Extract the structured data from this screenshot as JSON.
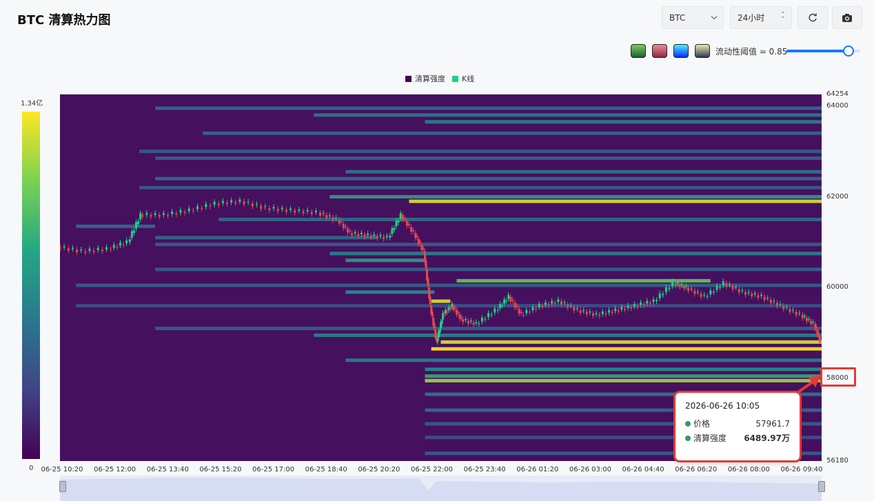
{
  "header": {
    "title": "BTC 清算热力图",
    "symbol": "BTC",
    "range": "24小时",
    "threshold_label": "流动性阈值 = 0.85"
  },
  "controls": {
    "threshold_value": 0.85,
    "swatches": [
      {
        "name": "viridis",
        "from": "#1c5c3f",
        "to": "#7ad151"
      },
      {
        "name": "reds",
        "from": "#8e2a3e",
        "to": "#f08a9a"
      },
      {
        "name": "blues",
        "from": "#0a2bff",
        "to": "#4ff0ff"
      },
      {
        "name": "sand",
        "from": "#2a3a55",
        "to": "#f4e6b0"
      }
    ]
  },
  "legend": {
    "liquidation": "清算强度",
    "kline": "K线",
    "liquidation_color": "#440154",
    "kline_color": "#1fd18a"
  },
  "colorbar": {
    "max_label": "1.34亿",
    "min_label": "0"
  },
  "tooltip": {
    "time": "2026-06-26 10:05",
    "price_label": "价格",
    "price_value": "57961.7",
    "intensity_label": "清算强度",
    "intensity_value": "6489.97万"
  },
  "highlight_price": "58000",
  "chart_data": {
    "type": "heatmap",
    "title": "BTC 清算热力图",
    "y_range": [
      56180,
      64254
    ],
    "y_ticks": [
      "64254",
      "64000",
      "62000",
      "60000",
      "58000",
      "56180"
    ],
    "x_ticks": [
      "06-25 10:20",
      "06-25 12:00",
      "06-25 13:40",
      "06-25 15:20",
      "06-25 17:00",
      "06-25 18:40",
      "06-25 20:20",
      "06-25 22:00",
      "06-25 23:40",
      "06-26 01:20",
      "06-26 03:00",
      "06-26 04:40",
      "06-26 06:20",
      "06-26 08:00",
      "06-26 09:40"
    ],
    "x_range_hours": [
      0,
      24
    ],
    "price_path": [
      [
        0.0,
        60900
      ],
      [
        0.8,
        60800
      ],
      [
        1.6,
        60850
      ],
      [
        2.2,
        61000
      ],
      [
        2.6,
        61600
      ],
      [
        3.4,
        61600
      ],
      [
        4.2,
        61700
      ],
      [
        5.0,
        61850
      ],
      [
        5.8,
        61900
      ],
      [
        6.6,
        61750
      ],
      [
        7.4,
        61700
      ],
      [
        8.2,
        61650
      ],
      [
        8.8,
        61500
      ],
      [
        9.2,
        61200
      ],
      [
        9.8,
        61150
      ],
      [
        10.4,
        61100
      ],
      [
        10.8,
        61600
      ],
      [
        11.2,
        61200
      ],
      [
        11.5,
        60800
      ],
      [
        11.7,
        59600
      ],
      [
        11.9,
        58800
      ],
      [
        12.1,
        59400
      ],
      [
        12.4,
        59600
      ],
      [
        12.7,
        59300
      ],
      [
        13.2,
        59200
      ],
      [
        13.8,
        59500
      ],
      [
        14.2,
        59800
      ],
      [
        14.6,
        59400
      ],
      [
        15.2,
        59600
      ],
      [
        15.8,
        59700
      ],
      [
        16.4,
        59500
      ],
      [
        17.0,
        59400
      ],
      [
        17.6,
        59500
      ],
      [
        18.2,
        59600
      ],
      [
        18.8,
        59700
      ],
      [
        19.4,
        60100
      ],
      [
        19.8,
        60000
      ],
      [
        20.4,
        59800
      ],
      [
        21.0,
        60100
      ],
      [
        21.6,
        59900
      ],
      [
        22.2,
        59800
      ],
      [
        22.8,
        59600
      ],
      [
        23.4,
        59400
      ],
      [
        23.8,
        59200
      ],
      [
        24.0,
        58800
      ]
    ],
    "liquidation_levels": [
      {
        "price": 63950,
        "start": 3.0,
        "end": 24.0,
        "intensity": 0.35
      },
      {
        "price": 63800,
        "start": 8.0,
        "end": 24.0,
        "intensity": 0.4
      },
      {
        "price": 63650,
        "start": 11.5,
        "end": 24.0,
        "intensity": 0.45
      },
      {
        "price": 63400,
        "start": 4.5,
        "end": 24.0,
        "intensity": 0.35
      },
      {
        "price": 63000,
        "start": 2.5,
        "end": 24.0,
        "intensity": 0.3
      },
      {
        "price": 62850,
        "start": 3.0,
        "end": 24.0,
        "intensity": 0.3
      },
      {
        "price": 62550,
        "start": 9.0,
        "end": 24.0,
        "intensity": 0.4
      },
      {
        "price": 62400,
        "start": 3.0,
        "end": 24.0,
        "intensity": 0.35
      },
      {
        "price": 62200,
        "start": 2.5,
        "end": 24.0,
        "intensity": 0.3
      },
      {
        "price": 62000,
        "start": 8.5,
        "end": 24.0,
        "intensity": 0.55
      },
      {
        "price": 61900,
        "start": 11.0,
        "end": 24.0,
        "intensity": 0.95
      },
      {
        "price": 61500,
        "start": 5.0,
        "end": 24.0,
        "intensity": 0.35
      },
      {
        "price": 61350,
        "start": 0.5,
        "end": 3.0,
        "intensity": 0.35
      },
      {
        "price": 61100,
        "start": 3.0,
        "end": 10.0,
        "intensity": 0.35
      },
      {
        "price": 60950,
        "start": 3.0,
        "end": 24.0,
        "intensity": 0.3
      },
      {
        "price": 60750,
        "start": 8.5,
        "end": 24.0,
        "intensity": 0.45
      },
      {
        "price": 60600,
        "start": 9.0,
        "end": 11.5,
        "intensity": 0.55
      },
      {
        "price": 60400,
        "start": 3.0,
        "end": 24.0,
        "intensity": 0.3
      },
      {
        "price": 60150,
        "start": 12.5,
        "end": 20.5,
        "intensity": 0.75
      },
      {
        "price": 60050,
        "start": 0.5,
        "end": 24.0,
        "intensity": 0.3
      },
      {
        "price": 59900,
        "start": 9.0,
        "end": 11.8,
        "intensity": 0.5
      },
      {
        "price": 59700,
        "start": 11.7,
        "end": 12.3,
        "intensity": 0.95
      },
      {
        "price": 59600,
        "start": 0.5,
        "end": 24.0,
        "intensity": 0.25
      },
      {
        "price": 59100,
        "start": 3.0,
        "end": 24.0,
        "intensity": 0.3
      },
      {
        "price": 58950,
        "start": 8.0,
        "end": 24.0,
        "intensity": 0.45
      },
      {
        "price": 58800,
        "start": 12.0,
        "end": 24.0,
        "intensity": 0.95
      },
      {
        "price": 58650,
        "start": 11.7,
        "end": 24.0,
        "intensity": 1.0
      },
      {
        "price": 58400,
        "start": 9.0,
        "end": 24.0,
        "intensity": 0.45
      },
      {
        "price": 58200,
        "start": 11.5,
        "end": 24.0,
        "intensity": 0.5
      },
      {
        "price": 58050,
        "start": 11.5,
        "end": 24.0,
        "intensity": 0.6
      },
      {
        "price": 57950,
        "start": 11.5,
        "end": 24.0,
        "intensity": 0.85
      },
      {
        "price": 57650,
        "start": 11.5,
        "end": 24.0,
        "intensity": 0.4
      },
      {
        "price": 57300,
        "start": 11.5,
        "end": 24.0,
        "intensity": 0.35
      },
      {
        "price": 57000,
        "start": 11.5,
        "end": 24.0,
        "intensity": 0.3
      },
      {
        "price": 56700,
        "start": 11.5,
        "end": 24.0,
        "intensity": 0.25
      },
      {
        "price": 56350,
        "start": 11.5,
        "end": 24.0,
        "intensity": 0.3
      }
    ]
  }
}
